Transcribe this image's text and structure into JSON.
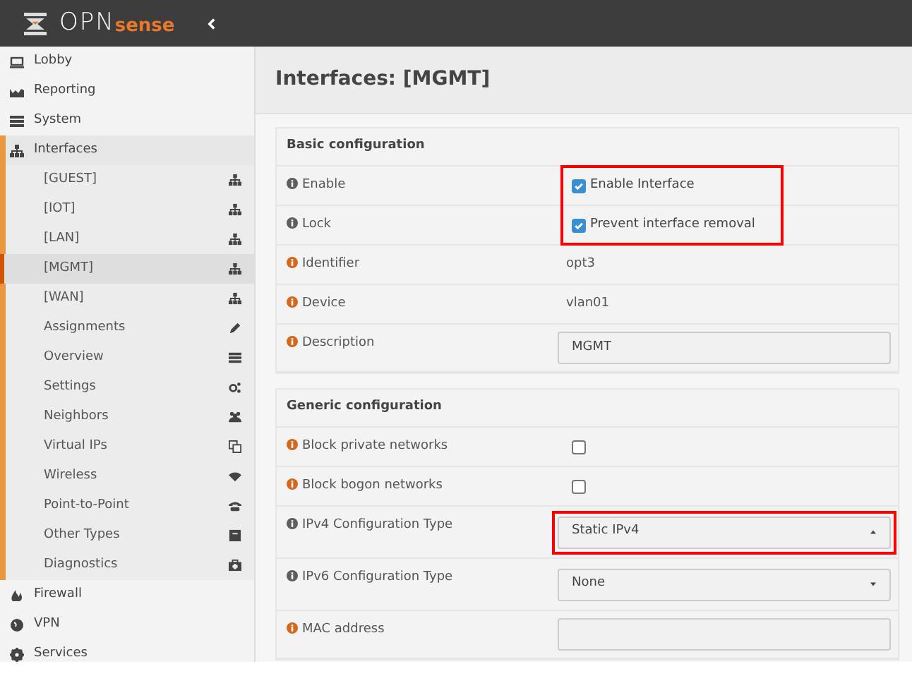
{
  "logo": {
    "text_main": "OPN",
    "text_accent": "sense"
  },
  "sidebar": {
    "items": [
      {
        "label": "Lobby",
        "selected": false
      },
      {
        "label": "Reporting",
        "selected": false
      },
      {
        "label": "System",
        "selected": false
      },
      {
        "label": "Interfaces",
        "selected": true,
        "expanded": true,
        "children": [
          {
            "label": "[GUEST]",
            "selected": false
          },
          {
            "label": "[IOT]",
            "selected": false
          },
          {
            "label": "[LAN]",
            "selected": false
          },
          {
            "label": "[MGMT]",
            "selected": true
          },
          {
            "label": "[WAN]",
            "selected": false
          },
          {
            "label": "Assignments",
            "selected": false
          },
          {
            "label": "Overview",
            "selected": false
          },
          {
            "label": "Settings",
            "selected": false
          },
          {
            "label": "Neighbors",
            "selected": false
          },
          {
            "label": "Virtual IPs",
            "selected": false
          },
          {
            "label": "Wireless",
            "selected": false
          },
          {
            "label": "Point-to-Point",
            "selected": false
          },
          {
            "label": "Other Types",
            "selected": false
          },
          {
            "label": "Diagnostics",
            "selected": false
          }
        ]
      },
      {
        "label": "Firewall",
        "selected": false
      },
      {
        "label": "VPN",
        "selected": false
      },
      {
        "label": "Services",
        "selected": false
      }
    ]
  },
  "page_title": "Interfaces: [MGMT]",
  "sections": [
    {
      "title": "Basic configuration",
      "rows": [
        {
          "label": "Enable",
          "color": "#5e5e5e",
          "kind": "checkbox",
          "checked": true,
          "value": "Enable Interface",
          "highlighted": true
        },
        {
          "label": "Lock",
          "color": "#5e5e5e",
          "kind": "checkbox",
          "checked": true,
          "value": "Prevent interface removal",
          "highlighted": true
        },
        {
          "label": "Identifier",
          "color": "#d2691e",
          "kind": "text",
          "value": "opt3",
          "highlighted": false
        },
        {
          "label": "Device",
          "color": "#d2691e",
          "kind": "text",
          "value": "vlan01",
          "highlighted": false
        },
        {
          "label": "Description",
          "color": "#d2691e",
          "kind": "input",
          "value": "MGMT",
          "highlighted": false
        }
      ]
    },
    {
      "title": "Generic configuration",
      "rows": [
        {
          "label": "Block private networks",
          "color": "#d2691e",
          "kind": "checkbox",
          "checked": false,
          "highlighted": false
        },
        {
          "label": "Block bogon networks",
          "color": "#d2691e",
          "kind": "checkbox",
          "checked": false,
          "highlighted": false
        },
        {
          "label": "IPv4 Configuration Type",
          "color": "#5e5e5e",
          "kind": "select",
          "value": "Static IPv4",
          "open": true,
          "highlighted": true
        },
        {
          "label": "IPv6 Configuration Type",
          "color": "#5e5e5e",
          "kind": "select",
          "value": "None",
          "open": false,
          "highlighted": false
        },
        {
          "label": "MAC address",
          "color": "#d2691e",
          "kind": "input",
          "highlighted": false
        }
      ]
    }
  ]
}
